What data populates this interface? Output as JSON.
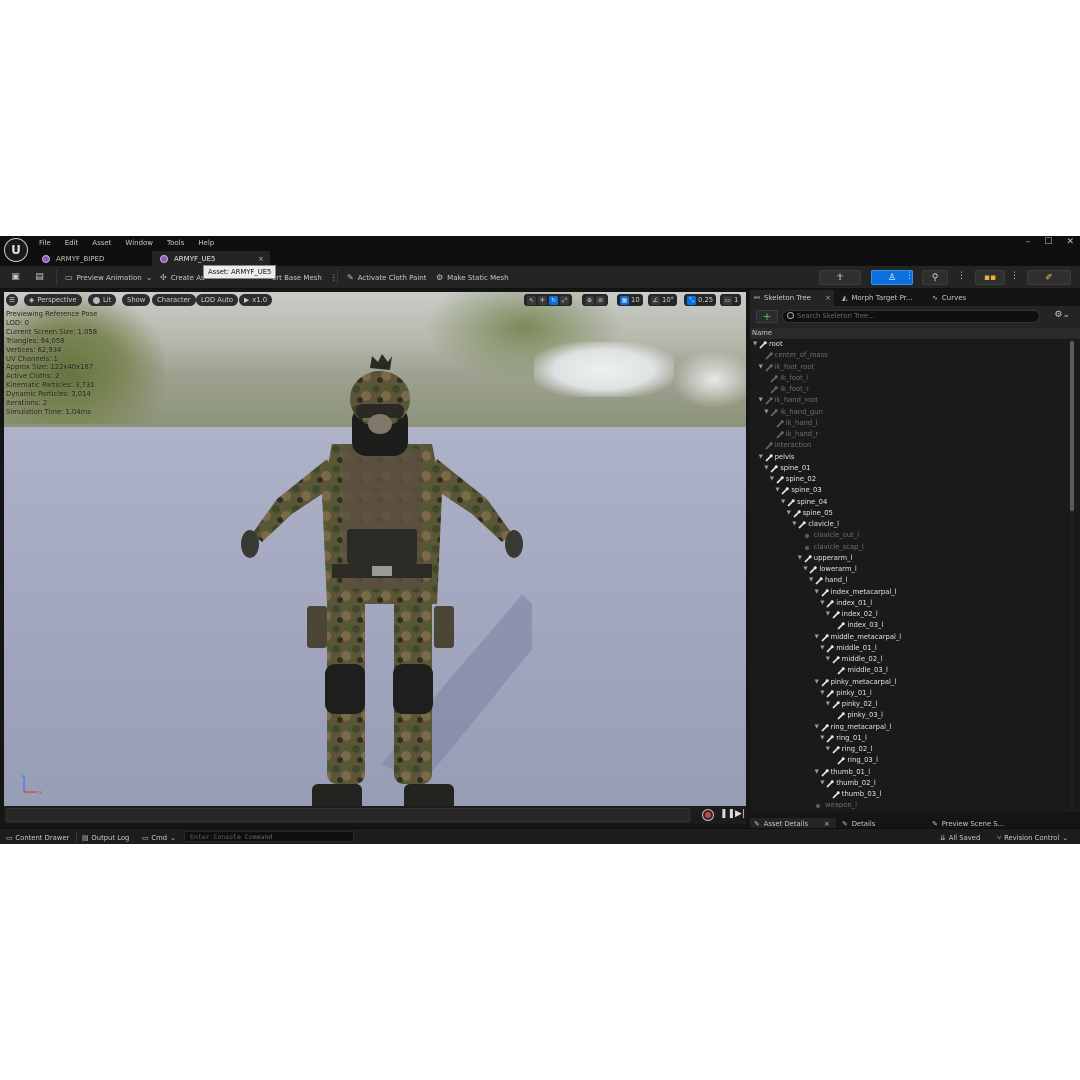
{
  "menu": [
    "File",
    "Edit",
    "Asset",
    "Window",
    "Tools",
    "Help"
  ],
  "tabs": [
    {
      "label": "ARMYF_BIPED",
      "active": false
    },
    {
      "label": "ARMYF_UE5",
      "active": true
    }
  ],
  "tab_close": "×",
  "window_controls": {
    "minimize": "–",
    "maximize": "☐",
    "close": "✕"
  },
  "tooltip": "Asset: ARMYF_UE5",
  "toolbar": {
    "preview_animation": "Preview Animation",
    "create_asset": "Create As",
    "import_base_mesh": "ort Base Mesh",
    "activate_cloth_paint": "Activate Cloth Paint",
    "make_static_mesh": "Make Static Mesh"
  },
  "viewport": {
    "perspective": "Perspective",
    "lit": "Lit",
    "show": "Show",
    "character": "Character",
    "lod": "LOD Auto",
    "play_speed": "x1.0",
    "grid_size": "10",
    "rotate_snap": "10°",
    "scale_snap": "0.25",
    "camera_speed": "1",
    "stats": [
      "Previewing Reference Pose",
      "LOD: 0",
      "Current Screen Size: 1.058",
      "Triangles: 94,058",
      "Vertices: 62,934",
      "UV Channels: 1",
      "Approx Size: 122x40x187",
      "Active Cloths: 2",
      "Kinematic Particles: 3,731",
      "Dynamic Particles: 3,014",
      "Iterations: 2",
      "Simulation Time: 1.04ms"
    ]
  },
  "skeleton_panel": {
    "tabs": [
      "Skeleton Tree",
      "Morph Target Pr...",
      "Curves"
    ],
    "close": "×",
    "search_placeholder": "Search Skeleton Tree...",
    "column_name": "Name",
    "add_label": "+"
  },
  "skeleton_tree": [
    {
      "name": "root",
      "depth": 0,
      "expanded": true,
      "kind": "bone"
    },
    {
      "name": "center_of_mass",
      "depth": 1,
      "expanded": false,
      "kind": "dim"
    },
    {
      "name": "ik_foot_root",
      "depth": 1,
      "expanded": true,
      "kind": "dim"
    },
    {
      "name": "ik_foot_l",
      "depth": 2,
      "expanded": false,
      "kind": "dim"
    },
    {
      "name": "ik_foot_r",
      "depth": 2,
      "expanded": false,
      "kind": "dim"
    },
    {
      "name": "ik_hand_root",
      "depth": 1,
      "expanded": true,
      "kind": "dim"
    },
    {
      "name": "ik_hand_gun",
      "depth": 2,
      "expanded": true,
      "kind": "dim"
    },
    {
      "name": "ik_hand_l",
      "depth": 3,
      "expanded": false,
      "kind": "dim"
    },
    {
      "name": "ik_hand_r",
      "depth": 3,
      "expanded": false,
      "kind": "dim"
    },
    {
      "name": "interaction",
      "depth": 1,
      "expanded": false,
      "kind": "dim"
    },
    {
      "name": "pelvis",
      "depth": 1,
      "expanded": true,
      "kind": "bone"
    },
    {
      "name": "spine_01",
      "depth": 2,
      "expanded": true,
      "kind": "bone"
    },
    {
      "name": "spine_02",
      "depth": 3,
      "expanded": true,
      "kind": "bone"
    },
    {
      "name": "spine_03",
      "depth": 4,
      "expanded": true,
      "kind": "bone"
    },
    {
      "name": "spine_04",
      "depth": 5,
      "expanded": true,
      "kind": "bone"
    },
    {
      "name": "spine_05",
      "depth": 6,
      "expanded": true,
      "kind": "bone"
    },
    {
      "name": "clavicle_l",
      "depth": 7,
      "expanded": true,
      "kind": "bone"
    },
    {
      "name": "clavicle_out_l",
      "depth": 8,
      "expanded": false,
      "kind": "socket"
    },
    {
      "name": "clavicle_scap_l",
      "depth": 8,
      "expanded": false,
      "kind": "socket"
    },
    {
      "name": "upperarm_l",
      "depth": 8,
      "expanded": true,
      "kind": "bone"
    },
    {
      "name": "lowerarm_l",
      "depth": 9,
      "expanded": true,
      "kind": "bone"
    },
    {
      "name": "hand_l",
      "depth": 10,
      "expanded": true,
      "kind": "bone"
    },
    {
      "name": "index_metacarpal_l",
      "depth": 11,
      "expanded": true,
      "kind": "bone"
    },
    {
      "name": "index_01_l",
      "depth": 12,
      "expanded": true,
      "kind": "bone"
    },
    {
      "name": "index_02_l",
      "depth": 13,
      "expanded": true,
      "kind": "bone"
    },
    {
      "name": "index_03_l",
      "depth": 14,
      "expanded": false,
      "kind": "bone"
    },
    {
      "name": "middle_metacarpal_l",
      "depth": 11,
      "expanded": true,
      "kind": "bone"
    },
    {
      "name": "middle_01_l",
      "depth": 12,
      "expanded": true,
      "kind": "bone"
    },
    {
      "name": "middle_02_l",
      "depth": 13,
      "expanded": true,
      "kind": "bone"
    },
    {
      "name": "middle_03_l",
      "depth": 14,
      "expanded": false,
      "kind": "bone"
    },
    {
      "name": "pinky_metacarpal_l",
      "depth": 11,
      "expanded": true,
      "kind": "bone"
    },
    {
      "name": "pinky_01_l",
      "depth": 12,
      "expanded": true,
      "kind": "bone"
    },
    {
      "name": "pinky_02_l",
      "depth": 13,
      "expanded": true,
      "kind": "bone"
    },
    {
      "name": "pinky_03_l",
      "depth": 14,
      "expanded": false,
      "kind": "bone"
    },
    {
      "name": "ring_metacarpal_l",
      "depth": 11,
      "expanded": true,
      "kind": "bone"
    },
    {
      "name": "ring_01_l",
      "depth": 12,
      "expanded": true,
      "kind": "bone"
    },
    {
      "name": "ring_02_l",
      "depth": 13,
      "expanded": true,
      "kind": "bone"
    },
    {
      "name": "ring_03_l",
      "depth": 14,
      "expanded": false,
      "kind": "bone"
    },
    {
      "name": "thumb_01_l",
      "depth": 11,
      "expanded": true,
      "kind": "bone"
    },
    {
      "name": "thumb_02_l",
      "depth": 12,
      "expanded": true,
      "kind": "bone"
    },
    {
      "name": "thumb_03_l",
      "depth": 13,
      "expanded": false,
      "kind": "bone"
    },
    {
      "name": "weapon_l",
      "depth": 10,
      "expanded": false,
      "kind": "socket"
    }
  ],
  "bottom_tabs": [
    "Asset Details",
    "Details",
    "Preview Scene S..."
  ],
  "status_bar": {
    "content_drawer": "Content Drawer",
    "output_log": "Output Log",
    "cmd": "Cmd",
    "console_placeholder": "Enter Console Command",
    "all_saved": "All Saved",
    "revision_control": "Revision Control"
  },
  "colors": {
    "accent_blue": "#0a70e0",
    "panel_bg": "#1a1a1a",
    "toolbar_bg": "#242424",
    "add_green": "#5ec35e"
  }
}
